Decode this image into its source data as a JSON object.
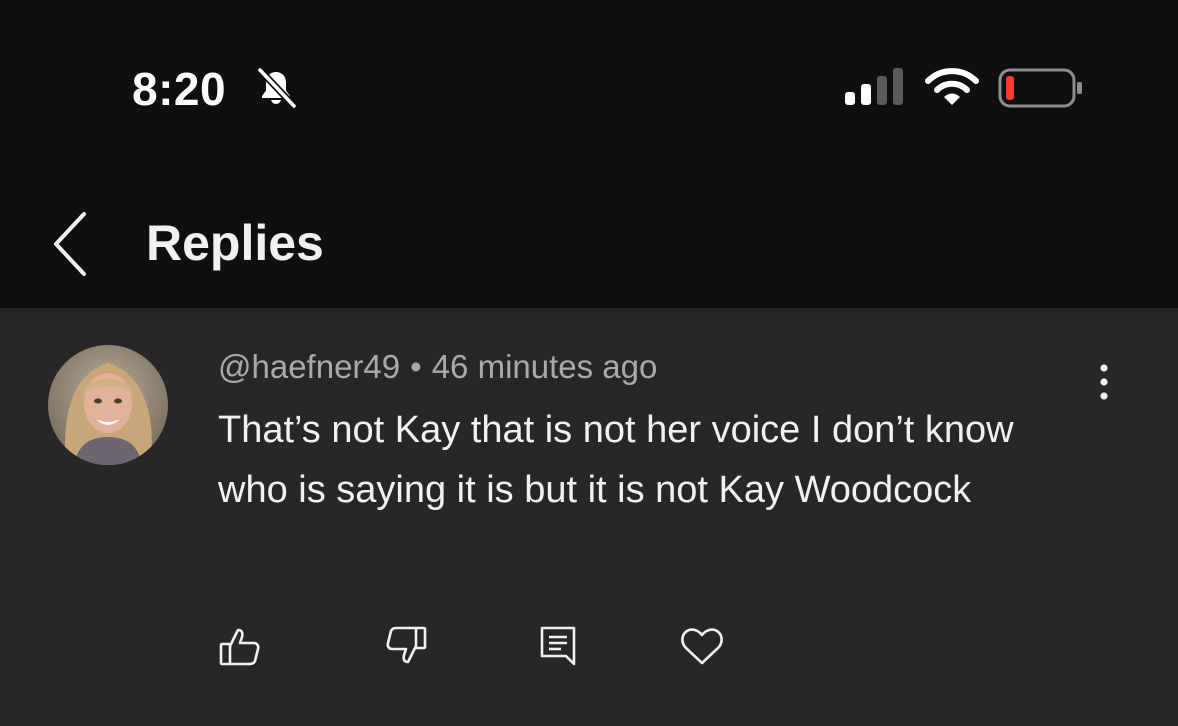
{
  "status_bar": {
    "time": "8:20",
    "icons": [
      "bell-slash-icon",
      "cellular-signal-icon",
      "wifi-icon",
      "battery-low-icon"
    ],
    "battery_color": "#ff3b30"
  },
  "header": {
    "title": "Replies",
    "back_icon": "chevron-left-icon"
  },
  "comment": {
    "username": "@haefner49",
    "separator": "•",
    "timestamp": "46 minutes ago",
    "text": "That’s not Kay that is not her voice I don’t know who is saying it is but it is not Kay Woodcock",
    "actions": [
      "thumbs-up-icon",
      "thumbs-down-icon",
      "reply-icon",
      "heart-icon"
    ],
    "menu_icon": "more-vertical-icon"
  },
  "colors": {
    "background": "#0f0f0f",
    "panel": "#272727",
    "text_primary": "#f1f1f1",
    "text_secondary": "#aaaaaa"
  }
}
